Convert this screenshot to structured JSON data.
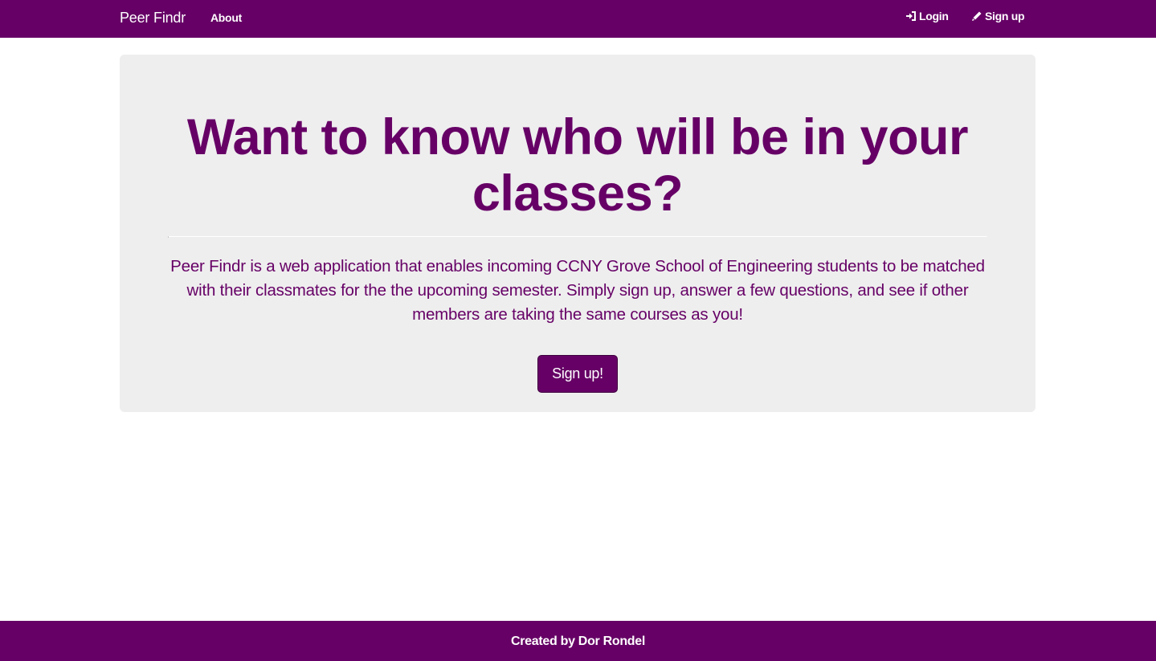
{
  "navbar": {
    "brand": "Peer Findr",
    "about_label": "About",
    "login": {
      "label": "Login",
      "icon": "log-in-icon"
    },
    "signup": {
      "label": "Sign up",
      "icon": "pencil-icon"
    }
  },
  "hero": {
    "headline": "Want to know who will be in your classes?",
    "description": "Peer Findr is a web application that enables incoming CCNY Grove School of Engineering students to be matched with their classmates for the the upcoming semester. Simply sign up, answer a few questions, and see if other members are taking the same courses as you!",
    "cta_label": "Sign up!"
  },
  "footer": {
    "text": "Created by Dor Rondel"
  },
  "colors": {
    "brand_purple": "#660066",
    "jumbotron_bg": "#eeeeee"
  }
}
